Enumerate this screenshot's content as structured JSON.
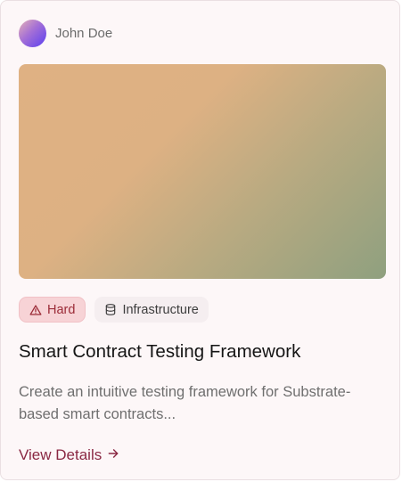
{
  "author": {
    "name": "John Doe",
    "avatar_gradient": [
      "#e6b2b6",
      "#a46fd6",
      "#5b3ff0"
    ]
  },
  "cover": {
    "gradient": [
      "#dfb183",
      "#b9aa81",
      "#8fa07f"
    ]
  },
  "tags": [
    {
      "label": "Hard",
      "icon": "warning-triangle-icon",
      "color": "#9b2b37",
      "background": "#f7d3d6"
    },
    {
      "label": "Infrastructure",
      "icon": "database-icon",
      "color": "#3d3d3d",
      "background": "#f5eef0"
    }
  ],
  "title": "Smart Contract Testing Framework",
  "description": "Create an intuitive testing framework for Substrate-based smart contracts...",
  "link": {
    "label": "View Details",
    "icon": "arrow-right-icon",
    "color": "#8a2843"
  }
}
